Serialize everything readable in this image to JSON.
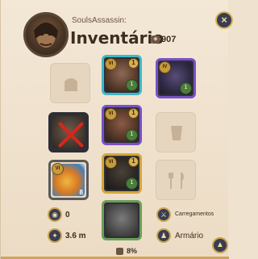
{
  "header": {
    "username": "SoulsAssassin:",
    "title": "Inventário",
    "weight_value": "907",
    "close_label": "×"
  },
  "slots": [
    {
      "name": "bag-slot",
      "state": "empty",
      "icon": "bag-icon"
    },
    {
      "name": "head-slot",
      "state": "item",
      "tier": "VI",
      "ench": "1",
      "qty": "1",
      "icon": "hood-icon"
    },
    {
      "name": "cape-slot",
      "state": "item",
      "tier": "IV",
      "ench": "",
      "qty": "1",
      "icon": "cape-icon"
    },
    {
      "name": "mainhand-slot",
      "state": "item",
      "tier": "",
      "ench": "",
      "qty": "",
      "icon": "crossbow-icon",
      "blocked": true
    },
    {
      "name": "chest-slot",
      "state": "item",
      "tier": "VI",
      "ench": "1",
      "qty": "1",
      "icon": "armor-icon"
    },
    {
      "name": "offhand-slot",
      "state": "empty",
      "icon": "offhand-icon"
    },
    {
      "name": "potion-slot",
      "state": "item",
      "tier": "VI",
      "ench": "",
      "qty": "8",
      "icon": "potion-icon"
    },
    {
      "name": "shoes-slot",
      "state": "item",
      "tier": "VI",
      "ench": "1",
      "qty": "1",
      "icon": "boots-icon"
    },
    {
      "name": "food-slot",
      "state": "empty",
      "icon": "fork-knife-icon"
    },
    {
      "name": "mount-slot",
      "state": "item",
      "tier": "",
      "ench": "",
      "qty": "",
      "icon": "mount-icon"
    }
  ],
  "footer": {
    "silver": "0",
    "fame": "3.6 m",
    "loadouts_label": "Carregamentos",
    "wardrobe_label": "Armário",
    "load_percent": "8%"
  },
  "colors": {
    "rarity_cyan": "#3fb8c7",
    "rarity_purple": "#7a4fc9",
    "rarity_gold": "#d5a63a",
    "rarity_green": "#6b9e5a"
  }
}
